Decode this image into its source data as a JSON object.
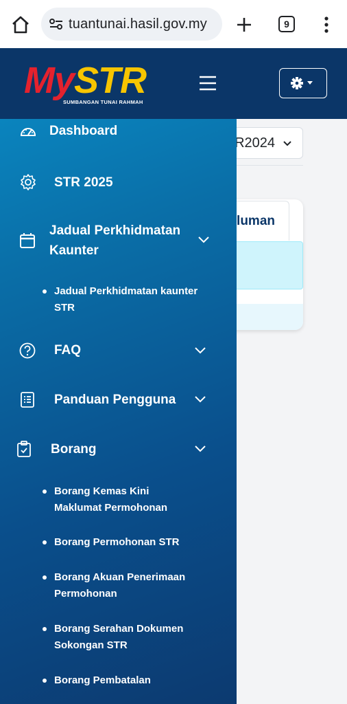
{
  "browser": {
    "url": "tuantunai.hasil.gov.my",
    "tab_count": "9"
  },
  "brand": {
    "logo_my": "My",
    "logo_str": "STR",
    "logo_subtitle": "SUMBANGAN TUNAI RAHMAH"
  },
  "main": {
    "year_select_value": "R2024",
    "card_tab_label": "kluman"
  },
  "sidebar": {
    "items": [
      {
        "label": "Dashboard",
        "icon": "dashboard-icon"
      },
      {
        "label": "STR 2025",
        "icon": "gear-icon"
      },
      {
        "label": "Jadual Perkhidmatan Kaunter",
        "icon": "calendar-icon"
      },
      {
        "label": "FAQ",
        "icon": "question-circle-icon"
      },
      {
        "label": "Panduan Pengguna",
        "icon": "document-list-icon"
      },
      {
        "label": "Borang",
        "icon": "clipboard-check-icon"
      }
    ],
    "jadual_sub": [
      "Jadual Perkhidmatan kaunter STR"
    ],
    "borang_sub": [
      "Borang Kemas Kini Maklumat Permohonan",
      "Borang Permohonan STR",
      "Borang Akuan Penerimaan Permohonan",
      "Borang Serahan Dokumen Sokongan STR",
      "Borang Pembatalan"
    ]
  },
  "colors": {
    "header_bg": "#0b3668",
    "sidebar_top": "#0a8ec8",
    "sidebar_bottom": "#0c3a70",
    "logo_red": "#e4222e",
    "logo_yellow": "#f7c500"
  }
}
